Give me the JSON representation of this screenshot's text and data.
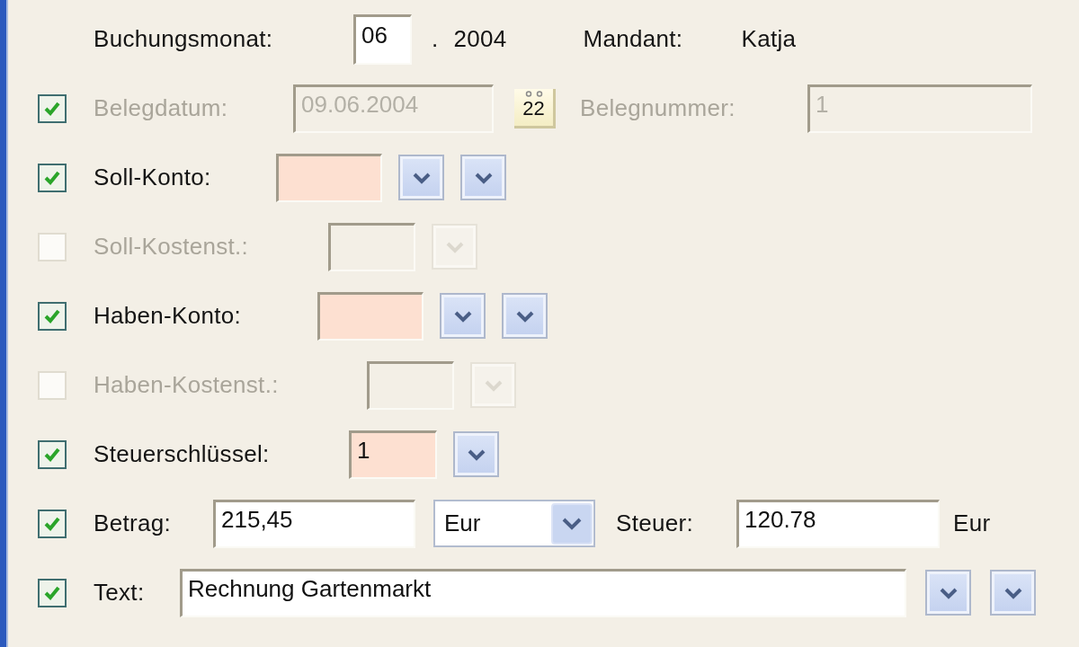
{
  "header": {
    "label": "Buchungsmonat:",
    "month": "06",
    "separator": ".",
    "year": "2004",
    "client_label": "Mandant:",
    "client": "Katja"
  },
  "rows": [
    {
      "kind": "date",
      "checkbox": {
        "checked": true,
        "disabled": false
      },
      "disabled": true,
      "label": "Belegdatum:",
      "field": {
        "value": "09.06.2004"
      },
      "calendar_button": "22",
      "number_label": "Belegnummer:",
      "number_field": {
        "value": "1"
      }
    },
    {
      "kind": "lookup",
      "checkbox": {
        "checked": true,
        "disabled": false
      },
      "disabled": false,
      "label": "Soll-Konto:",
      "field": {
        "required": true
      },
      "buttons": [
        {
          "disabled": false
        },
        {
          "disabled": false
        }
      ]
    },
    {
      "kind": "lookup",
      "checkbox": {
        "checked": false,
        "disabled": true
      },
      "disabled": true,
      "label": "Soll-Kostenst.:",
      "field": {
        "required": false
      },
      "buttons": [
        {
          "disabled": true
        }
      ]
    },
    {
      "kind": "lookup",
      "checkbox": {
        "checked": true,
        "disabled": false
      },
      "disabled": false,
      "label": "Haben-Konto:",
      "field": {
        "required": true
      },
      "buttons": [
        {
          "disabled": false
        },
        {
          "disabled": false
        }
      ]
    },
    {
      "kind": "lookup",
      "checkbox": {
        "checked": false,
        "disabled": true
      },
      "disabled": true,
      "label": "Haben-Kostenst.:",
      "field": {
        "required": false
      },
      "buttons": [
        {
          "disabled": true
        }
      ]
    },
    {
      "kind": "lookup",
      "checkbox": {
        "checked": true,
        "disabled": false
      },
      "disabled": false,
      "label": "Steuerschlüssel:",
      "field": {
        "value": "1",
        "required": true
      },
      "buttons": [
        {
          "disabled": false
        }
      ]
    },
    {
      "kind": "amount",
      "checkbox": {
        "checked": true,
        "disabled": false
      },
      "disabled": false,
      "label": "Betrag:",
      "field": {
        "value": "215,45"
      },
      "currency": "Eur",
      "tax_label": "Steuer:",
      "tax_field": {
        "value": "120.78"
      },
      "tax_unit": "Eur"
    },
    {
      "kind": "text",
      "checkbox": {
        "checked": true,
        "disabled": false
      },
      "disabled": false,
      "label": "Text:",
      "field": {
        "value": "Rechnung Gartenmarkt"
      },
      "buttons": [
        {
          "disabled": false
        },
        {
          "disabled": false
        }
      ]
    }
  ]
}
